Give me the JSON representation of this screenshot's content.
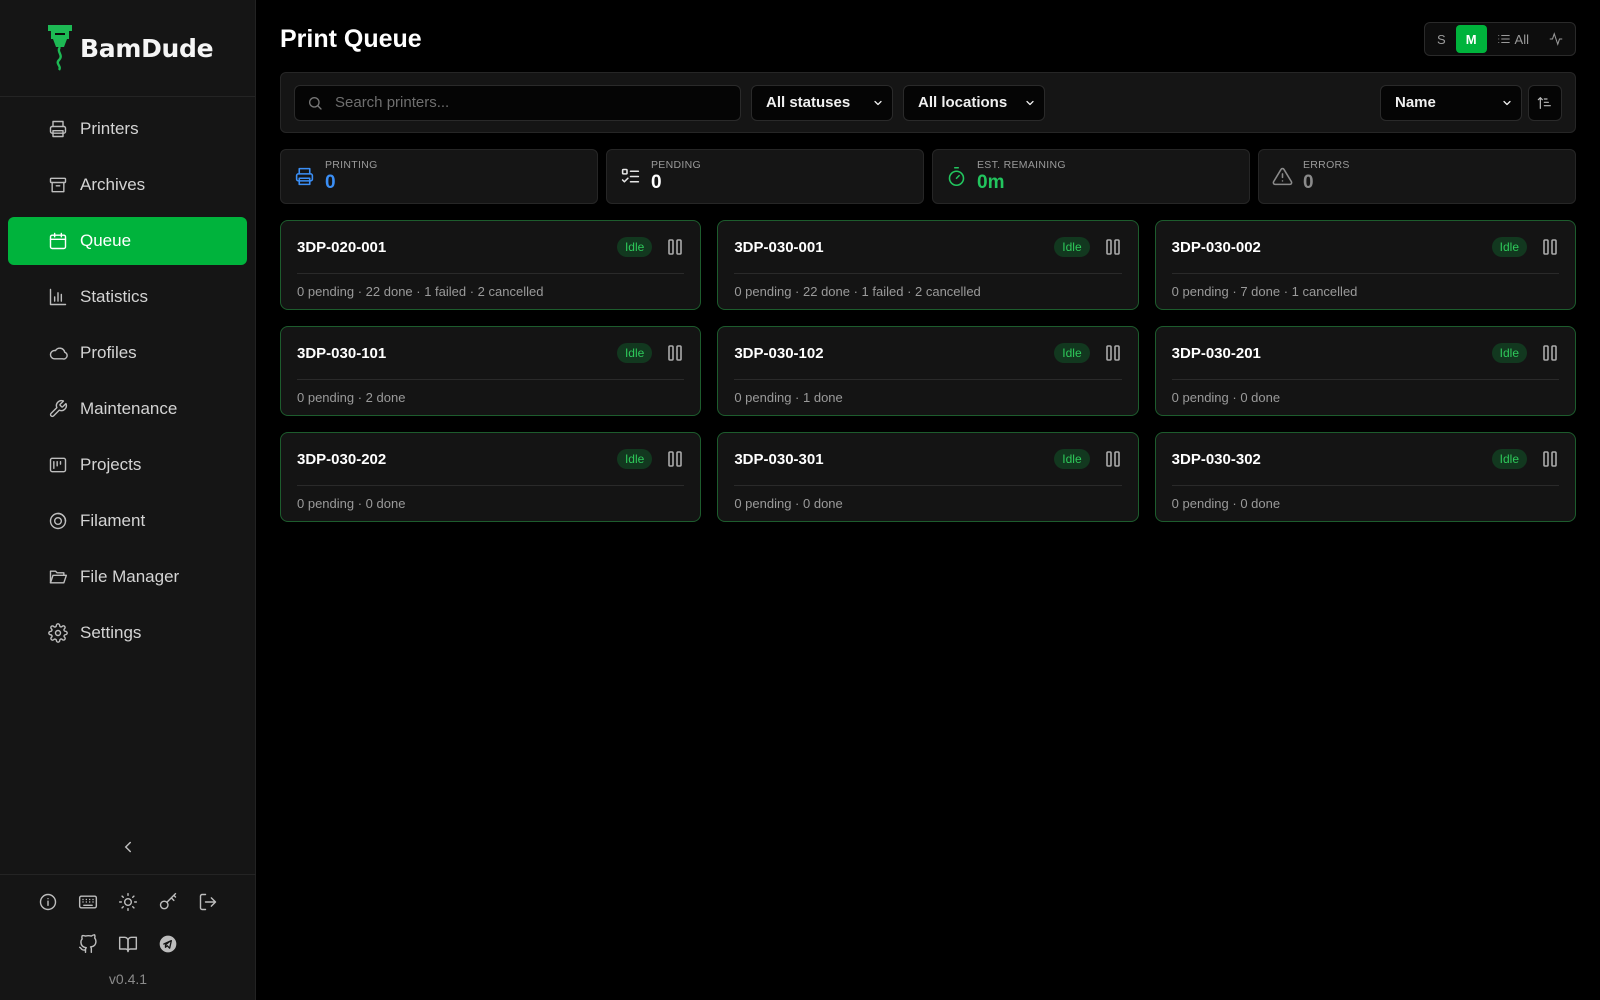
{
  "brand": {
    "name": "BamDude",
    "logo_icon": "bamdude-logo-icon"
  },
  "sidebar": {
    "items": [
      {
        "label": "Printers",
        "icon": "printer-icon",
        "active": false
      },
      {
        "label": "Archives",
        "icon": "archive-icon",
        "active": false
      },
      {
        "label": "Queue",
        "icon": "calendar-icon",
        "active": true
      },
      {
        "label": "Statistics",
        "icon": "bar-chart-icon",
        "active": false
      },
      {
        "label": "Profiles",
        "icon": "cloud-icon",
        "active": false
      },
      {
        "label": "Maintenance",
        "icon": "wrench-icon",
        "active": false
      },
      {
        "label": "Projects",
        "icon": "projects-icon",
        "active": false
      },
      {
        "label": "Filament",
        "icon": "filament-icon",
        "active": false
      },
      {
        "label": "File Manager",
        "icon": "folder-open-icon",
        "active": false
      },
      {
        "label": "Settings",
        "icon": "gear-icon",
        "active": false
      }
    ],
    "footer_icons_row1": [
      "info-icon",
      "keyboard-icon",
      "sun-icon",
      "key-icon",
      "logout-icon"
    ],
    "footer_icons_row2": [
      "github-icon",
      "book-icon",
      "telegram-icon"
    ],
    "version": "v0.4.1"
  },
  "header": {
    "title": "Print Queue",
    "view_toggle": {
      "small": "S",
      "medium": "M",
      "all": "All",
      "active": "M"
    }
  },
  "filters": {
    "search_placeholder": "Search printers...",
    "status": "All statuses",
    "location": "All locations",
    "sort": "Name"
  },
  "stats": [
    {
      "label": "PRINTING",
      "value": "0",
      "color": "#3b8ff6",
      "icon": "printer-icon"
    },
    {
      "label": "PENDING",
      "value": "0",
      "color": "#ffffff",
      "icon": "checklist-icon"
    },
    {
      "label": "EST. REMAINING",
      "value": "0m",
      "color": "#22c55e",
      "icon": "timer-icon"
    },
    {
      "label": "ERRORS",
      "value": "0",
      "color": "#8a8a8a",
      "icon": "warning-icon"
    }
  ],
  "printers": [
    {
      "name": "3DP-020-001",
      "status": "Idle",
      "summary": "0 pending · 22 done · 1 failed · 2 cancelled"
    },
    {
      "name": "3DP-030-001",
      "status": "Idle",
      "summary": "0 pending · 22 done · 1 failed · 2 cancelled"
    },
    {
      "name": "3DP-030-002",
      "status": "Idle",
      "summary": "0 pending · 7 done · 1 cancelled"
    },
    {
      "name": "3DP-030-101",
      "status": "Idle",
      "summary": "0 pending · 2 done"
    },
    {
      "name": "3DP-030-102",
      "status": "Idle",
      "summary": "0 pending · 1 done"
    },
    {
      "name": "3DP-030-201",
      "status": "Idle",
      "summary": "0 pending · 0 done"
    },
    {
      "name": "3DP-030-202",
      "status": "Idle",
      "summary": "0 pending · 0 done"
    },
    {
      "name": "3DP-030-301",
      "status": "Idle",
      "summary": "0 pending · 0 done"
    },
    {
      "name": "3DP-030-302",
      "status": "Idle",
      "summary": "0 pending · 0 done"
    }
  ],
  "colors": {
    "accent": "#00b33c",
    "idle_badge": "#2ec95a",
    "card_border": "#1d5c2d"
  }
}
